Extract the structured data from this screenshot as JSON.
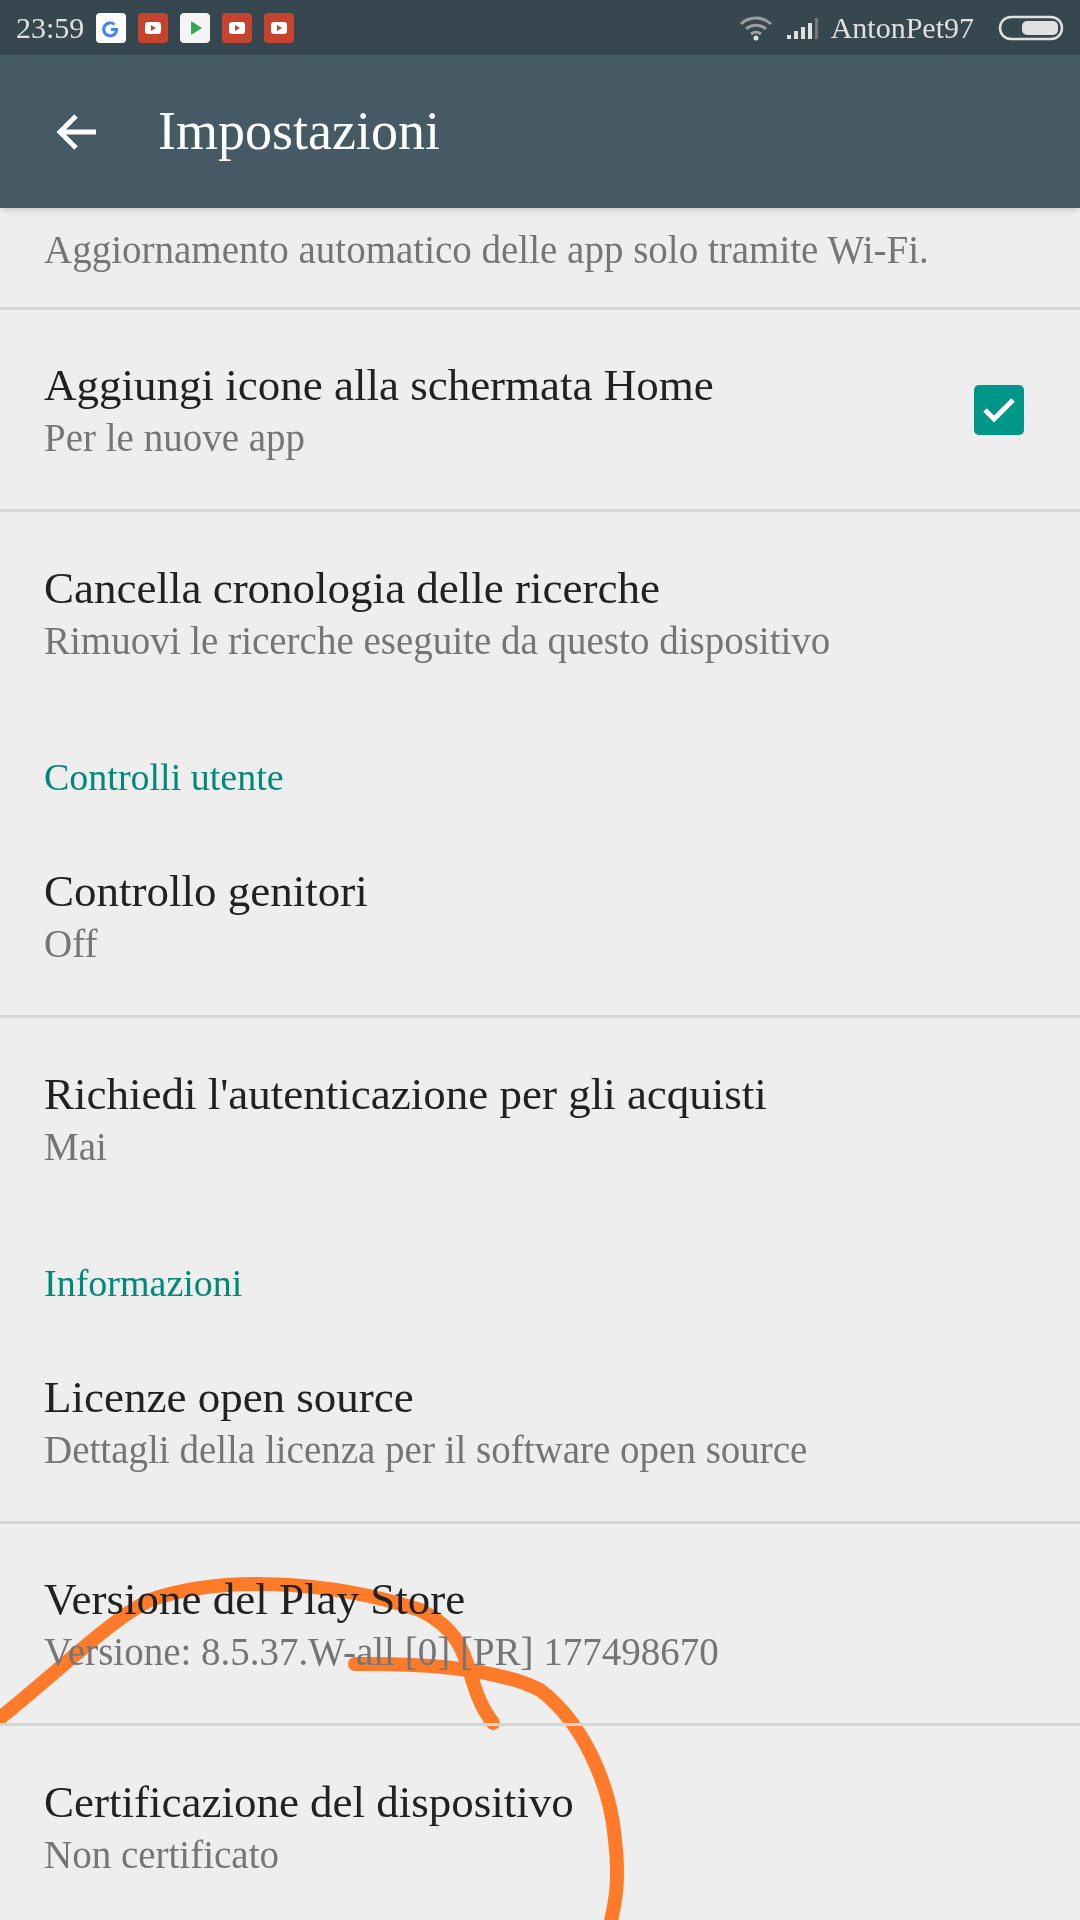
{
  "status_bar": {
    "time": "23:59",
    "carrier": "AntonPet97"
  },
  "toolbar": {
    "title": "Impostazioni"
  },
  "settings": [
    {
      "kind": "item",
      "subtitle": "Aggiornamento automatico delle app solo tramite Wi-Fi."
    },
    {
      "kind": "checkbox",
      "title": "Aggiungi icone alla schermata Home",
      "subtitle": "Per le nuove app",
      "checked": true
    },
    {
      "kind": "item",
      "title": "Cancella cronologia delle ricerche",
      "subtitle": "Rimuovi le ricerche eseguite da questo dispositivo"
    },
    {
      "kind": "section",
      "title": "Controlli utente"
    },
    {
      "kind": "item",
      "title": "Controllo genitori",
      "subtitle": "Off"
    },
    {
      "kind": "item",
      "title": "Richiedi l'autenticazione per gli acquisti",
      "subtitle": "Mai"
    },
    {
      "kind": "section",
      "title": "Informazioni"
    },
    {
      "kind": "item",
      "title": "Licenze open source",
      "subtitle": "Dettagli della licenza per il software open source"
    },
    {
      "kind": "item",
      "title": "Versione del Play Store",
      "subtitle": "Versione: 8.5.37.W-all [0] [PR] 177498670"
    },
    {
      "kind": "item",
      "title": "Certificazione del dispositivo",
      "subtitle": "Non certificato"
    }
  ]
}
